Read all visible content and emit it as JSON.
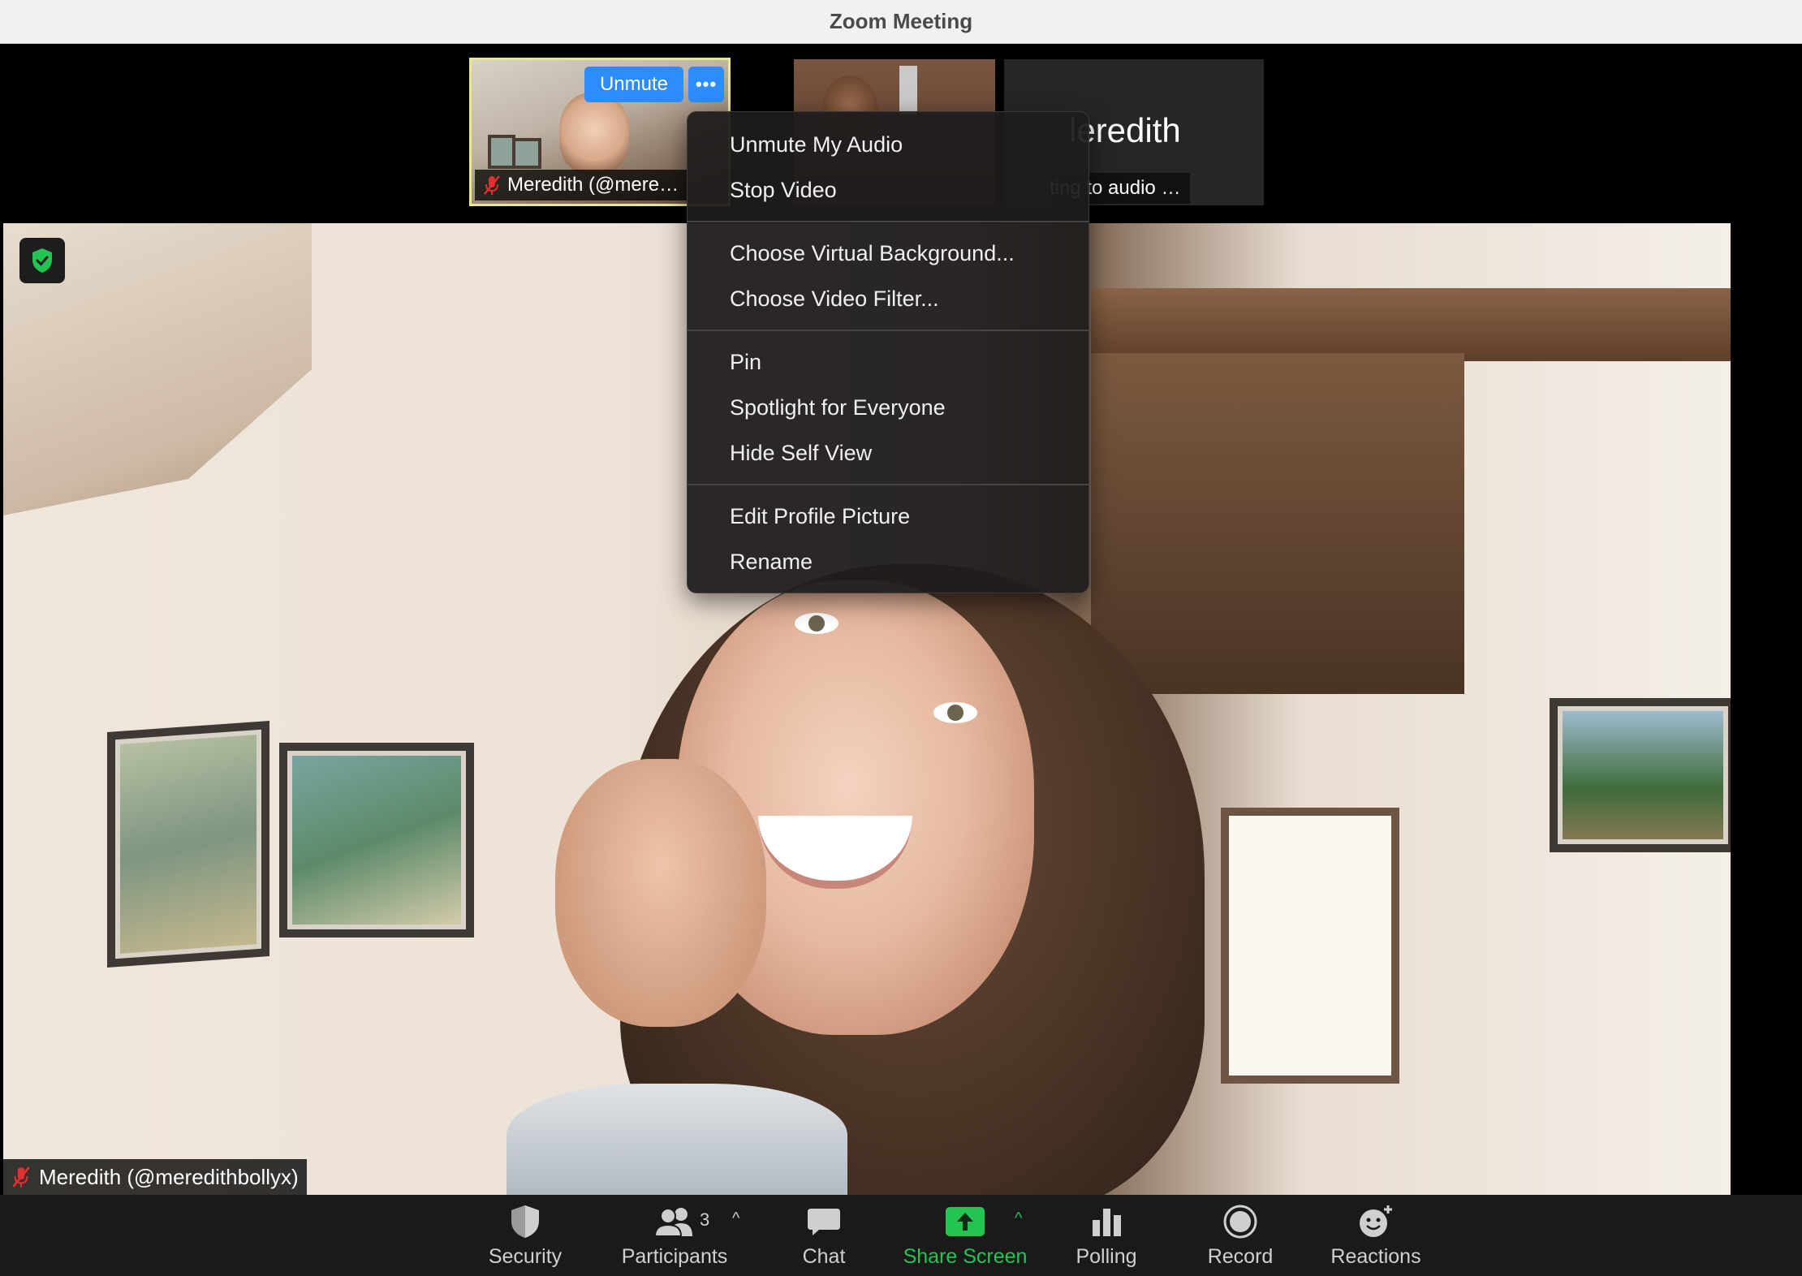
{
  "window": {
    "title": "Zoom Meeting"
  },
  "thumbnails": {
    "self": {
      "name": "Meredith (@mere…",
      "unmute_label": "Unmute",
      "more_label": "•••"
    },
    "name_tile": {
      "name_fragment": "leredith",
      "status": "ting to audio …"
    }
  },
  "main_video": {
    "participant_label": "Meredith (@meredithbollyx)"
  },
  "context_menu": {
    "groups": [
      [
        "Unmute My Audio",
        "Stop Video"
      ],
      [
        "Choose Virtual Background...",
        "Choose Video Filter..."
      ],
      [
        "Pin",
        "Spotlight for Everyone",
        "Hide Self View"
      ],
      [
        "Edit Profile Picture",
        "Rename"
      ]
    ]
  },
  "toolbar": {
    "security": "Security",
    "participants": "Participants",
    "participants_count": "3",
    "chat": "Chat",
    "share_screen": "Share Screen",
    "polling": "Polling",
    "record": "Record",
    "reactions": "Reactions",
    "caret": "^"
  },
  "colors": {
    "accent_blue": "#2d8cff",
    "share_green": "#23c552",
    "self_border": "#e9e98c",
    "muted_red": "#e0302f"
  }
}
